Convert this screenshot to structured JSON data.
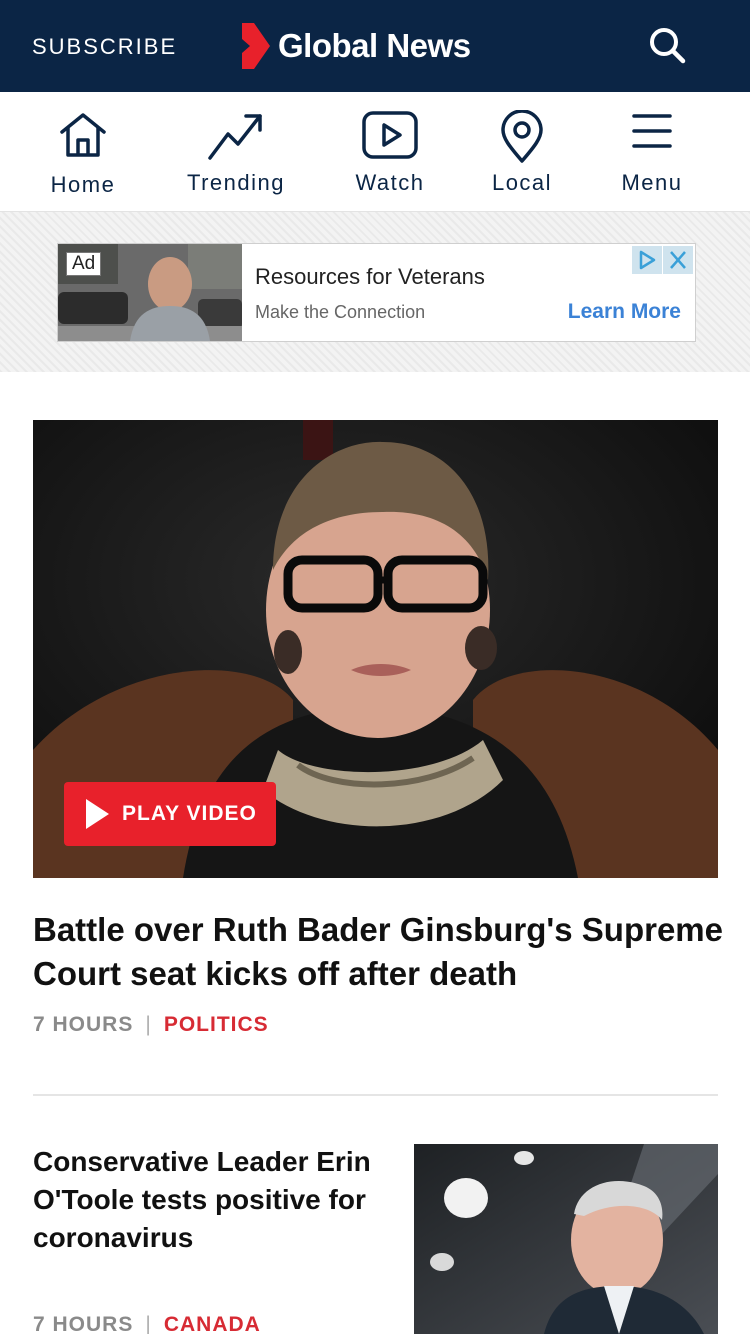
{
  "header": {
    "subscribe_label": "SUBSCRIBE",
    "logo_text": "Global News",
    "brand_red": "#e8212b",
    "brand_navy": "#0b2545",
    "search_icon": "search-icon"
  },
  "nav": {
    "items": [
      {
        "label": "Home",
        "icon": "home-icon"
      },
      {
        "label": "Trending",
        "icon": "trending-icon"
      },
      {
        "label": "Watch",
        "icon": "play-icon"
      },
      {
        "label": "Local",
        "icon": "location-pin-icon"
      },
      {
        "label": "Menu",
        "icon": "hamburger-menu-icon"
      }
    ]
  },
  "ad": {
    "tag": "Ad",
    "title": "Resources for Veterans",
    "subtitle": "Make the Connection",
    "cta": "Learn More"
  },
  "lead_story": {
    "play_label": "PLAY VIDEO",
    "headline": "Battle over Ruth Bader Ginsburg's Supreme Court seat kicks off after death",
    "time": "7 HOURS",
    "category": "POLITICS"
  },
  "second_story": {
    "headline": "Conservative Leader Erin O'Toole tests positive for coronavirus",
    "time": "7 HOURS",
    "category": "CANADA"
  }
}
